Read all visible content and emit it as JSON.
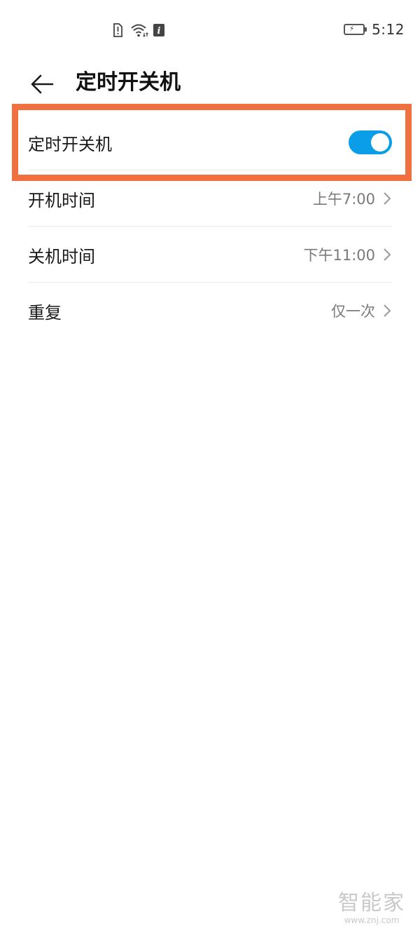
{
  "status_bar": {
    "time": "5:12",
    "icons": [
      "sim-alert-icon",
      "wifi-icon",
      "info-icon",
      "battery-charging-icon"
    ]
  },
  "header": {
    "title": "定时开关机",
    "back_icon": "back-arrow-icon"
  },
  "settings": {
    "timer_toggle": {
      "label": "定时开关机",
      "enabled": true
    },
    "power_on_time": {
      "label": "开机时间",
      "value": "上午7:00"
    },
    "power_off_time": {
      "label": "关机时间",
      "value": "下午11:00"
    },
    "repeat": {
      "label": "重复",
      "value": "仅一次"
    }
  },
  "watermark": {
    "logo": "智能家",
    "url": "www.znj.com"
  },
  "colors": {
    "accent": "#0a9ee8",
    "highlight": "#f07040",
    "secondary_text": "#7a7a7a"
  }
}
